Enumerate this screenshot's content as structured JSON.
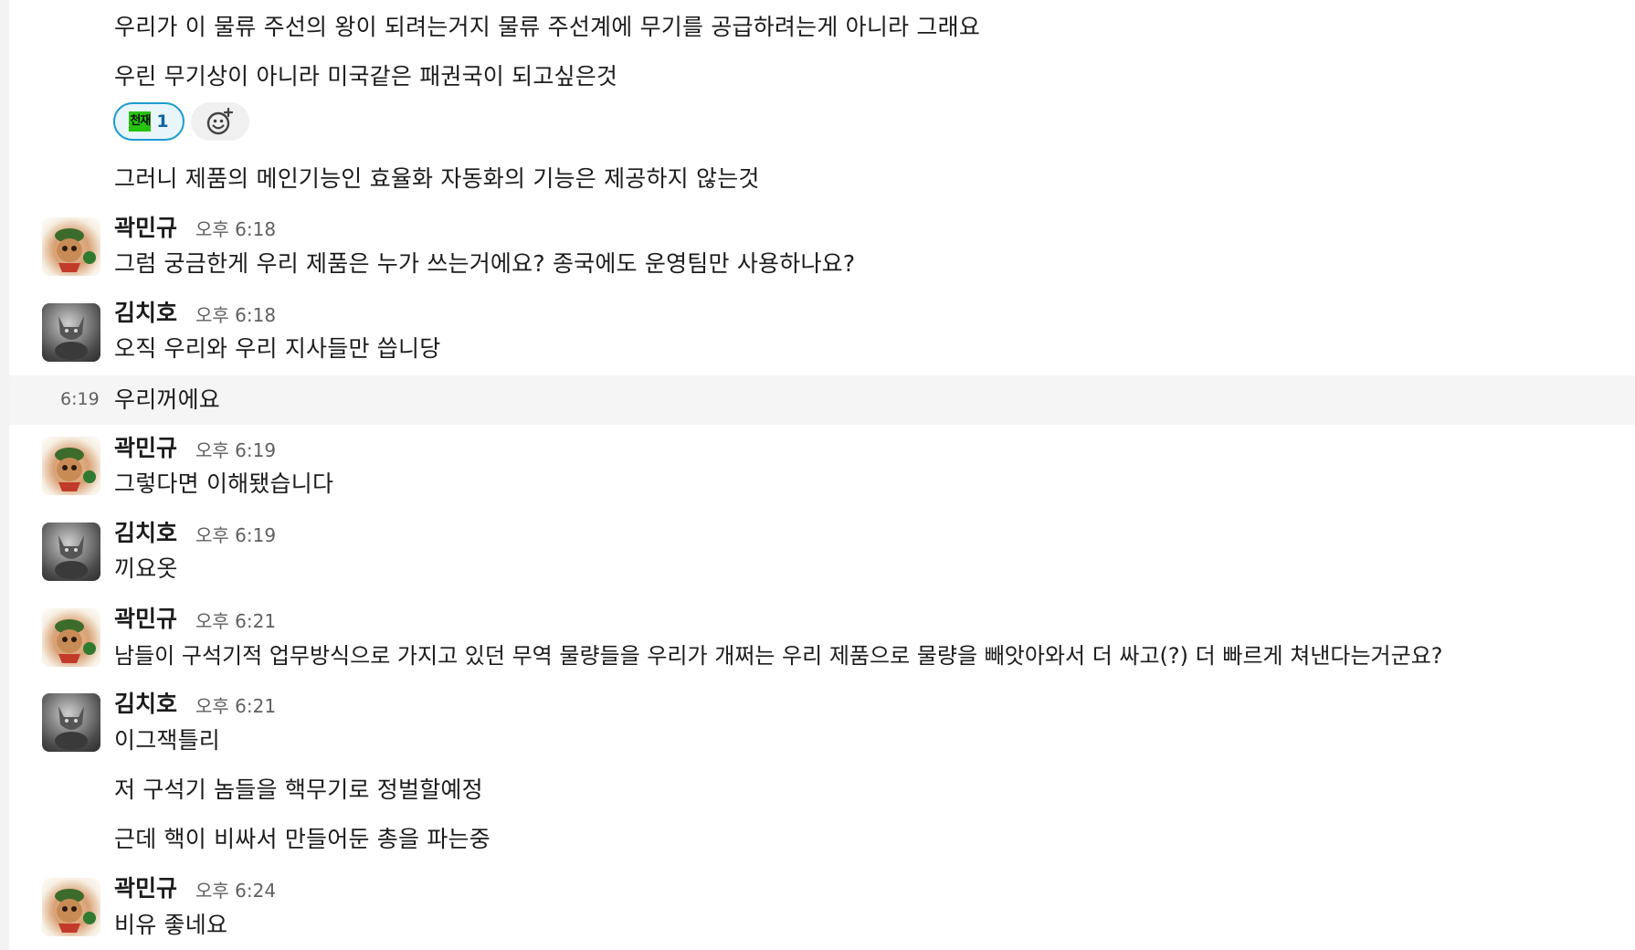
{
  "messages": {
    "m1": "우리가 이 물류 주선의 왕이 되려는거지 물류 주선계에 무기를 공급하려는게 아니라 그래요",
    "m2": "우린 무기상이 아니라 미국같은 패권국이 되고싶은것",
    "m3": "그러니 제품의 메인기능인 효율화 자동화의 기능은 제공하지 않는것",
    "m4": "그럼 궁금한게 우리 제품은 누가 쓰는거에요? 종국에도 운영팀만 사용하나요?",
    "m5": "오직 우리와 우리 지사들만 씁니당",
    "m6": "우리꺼에요",
    "m7": "그렇다면 이해됐습니다",
    "m8": "끼요옷",
    "m9": "남들이 구석기적 업무방식으로 가지고 있던 무역 물량들을 우리가 개쩌는 우리 제품으로 물량을 빼앗아와서 더 싸고(?) 더 빠르게 쳐낸다는거군요?",
    "m10": "이그잭틀리",
    "m11": "저 구석기 놈들을 핵무기로 정벌할예정",
    "m12": "근데 핵이 비싸서 만들어둔 총을 파는중",
    "m13": "비유 좋네요"
  },
  "reaction": {
    "emoji_label": "천재",
    "count": "1"
  },
  "users": {
    "kwak": "곽민규",
    "kim": "김치호"
  },
  "times": {
    "t1": "오후 6:18",
    "t2": "오후 6:18",
    "hover": "6:19",
    "t3": "오후 6:19",
    "t4": "오후 6:19",
    "t5": "오후 6:21",
    "t6": "오후 6:21",
    "t7": "오후 6:24"
  },
  "colors": {
    "reaction_border": "#1d9bd1",
    "reaction_count": "#1264a3",
    "emoji_bg": "#26c30f"
  }
}
